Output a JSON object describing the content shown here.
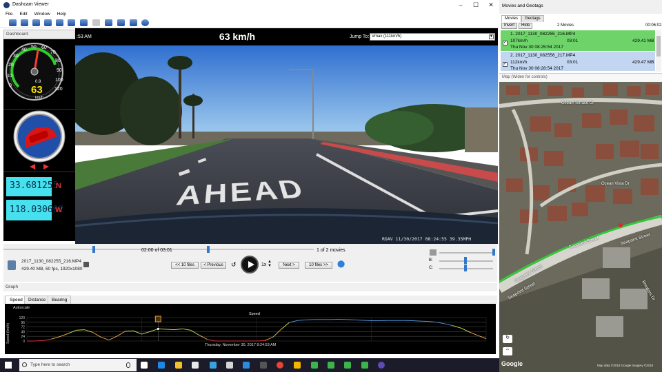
{
  "window": {
    "title": "Dashcam Viewer"
  },
  "menu": [
    "File",
    "Edit",
    "Window",
    "Help"
  ],
  "dashboard": {
    "header": "Dashboard",
    "gauge_ticks": [
      "0",
      "10",
      "20",
      "30",
      "40",
      "50",
      "60",
      "70",
      "80",
      "90",
      "100",
      "110",
      "120"
    ],
    "speed_value": "63",
    "gauge_decimal": "0.9",
    "speed_unit": "km/h",
    "latitude": "33.681255",
    "latitude_dir": "N",
    "longitude": "118.030602",
    "longitude_dir": "W"
  },
  "video": {
    "time_partial": ":53 AM",
    "speed_display": "63 km/h",
    "jump_label": "Jump To:",
    "jump_value": "Vmax (111km/h)",
    "stamp": "ROAV 11/30/2017 08:24:55 39.35MPH",
    "road_text": "AHEAD"
  },
  "controls": {
    "time_text": "02:00 of 03:01",
    "movies_count": "1 of 2 movies",
    "file_name": "2017_1130_082255_216.MP4",
    "file_details": "429.40 MB, 60 fps, 1920x1080",
    "prev10": "<< 10 files",
    "previous": "< Previous",
    "rate": "1x",
    "next": "Next >",
    "next10": "10 files >>",
    "slider_b": "B:",
    "slider_c": "C:",
    "progress": 0.66
  },
  "graph": {
    "header": "Graph",
    "tabs": [
      "Speed",
      "Distance",
      "Bearing"
    ],
    "autoscale": "Autoscale",
    "title": "Speed",
    "ylabel": "Speed (km/h)",
    "yticks": [
      "120",
      "96",
      "72",
      "48",
      "24",
      "0"
    ],
    "footer": "Thursday, November 30, 2017 8:24:53 AM"
  },
  "chart_data": {
    "type": "line",
    "title": "Speed",
    "xlabel": "Thursday, November 30, 2017 8:24:53 AM",
    "ylabel": "Speed (km/h)",
    "ylim": [
      0,
      120
    ],
    "series": [
      {
        "values": [
          0,
          0,
          2,
          10,
          22,
          38,
          55,
          58,
          45,
          20,
          5,
          25,
          50,
          52,
          35,
          48,
          62,
          60,
          58,
          62,
          55,
          30,
          8,
          0,
          0,
          0,
          0,
          0,
          0,
          2,
          20,
          60,
          95,
          105,
          108,
          110,
          110,
          110,
          111,
          110,
          108,
          106,
          104,
          104,
          105,
          105,
          105,
          104,
          102,
          100,
          96,
          88,
          78,
          65,
          45,
          28,
          12
        ]
      }
    ]
  },
  "movies_panel": {
    "title": "Movies and Geotags",
    "tabs": [
      "Movies",
      "Geotags"
    ],
    "invert": "Invert",
    "hide": "Hide",
    "count": "2 Movies",
    "total_time": "00:06:02",
    "movies": [
      {
        "name": "1. 2017_1130_082255_216.MP4",
        "speed": "107km/h",
        "duration": "03:01",
        "size": "429.41 MB",
        "date": "Thu Nov 30 08:25:54 2017",
        "color": "#6ed46a"
      },
      {
        "name": "2. 2017_1130_082556_217.MP4",
        "speed": "112km/h",
        "duration": "03:01",
        "size": "429.47 MB",
        "date": "Thu Nov 30 08:28:54 2017",
        "color": "#c2d6f2"
      }
    ]
  },
  "map": {
    "header": "Map (Widen for controls)",
    "streets": [
      "Ocean Terrace Dr",
      "Ocean Vista Dr",
      "Seapoint Street",
      "Seapoint Street",
      "Seapoint Street",
      "Seapoint Street",
      "Breakers Dr"
    ],
    "google_logo": "Google",
    "attribution": "Map data ©2018 Google Imagery ©2018"
  },
  "taskbar": {
    "search_placeholder": "Type here to search"
  }
}
